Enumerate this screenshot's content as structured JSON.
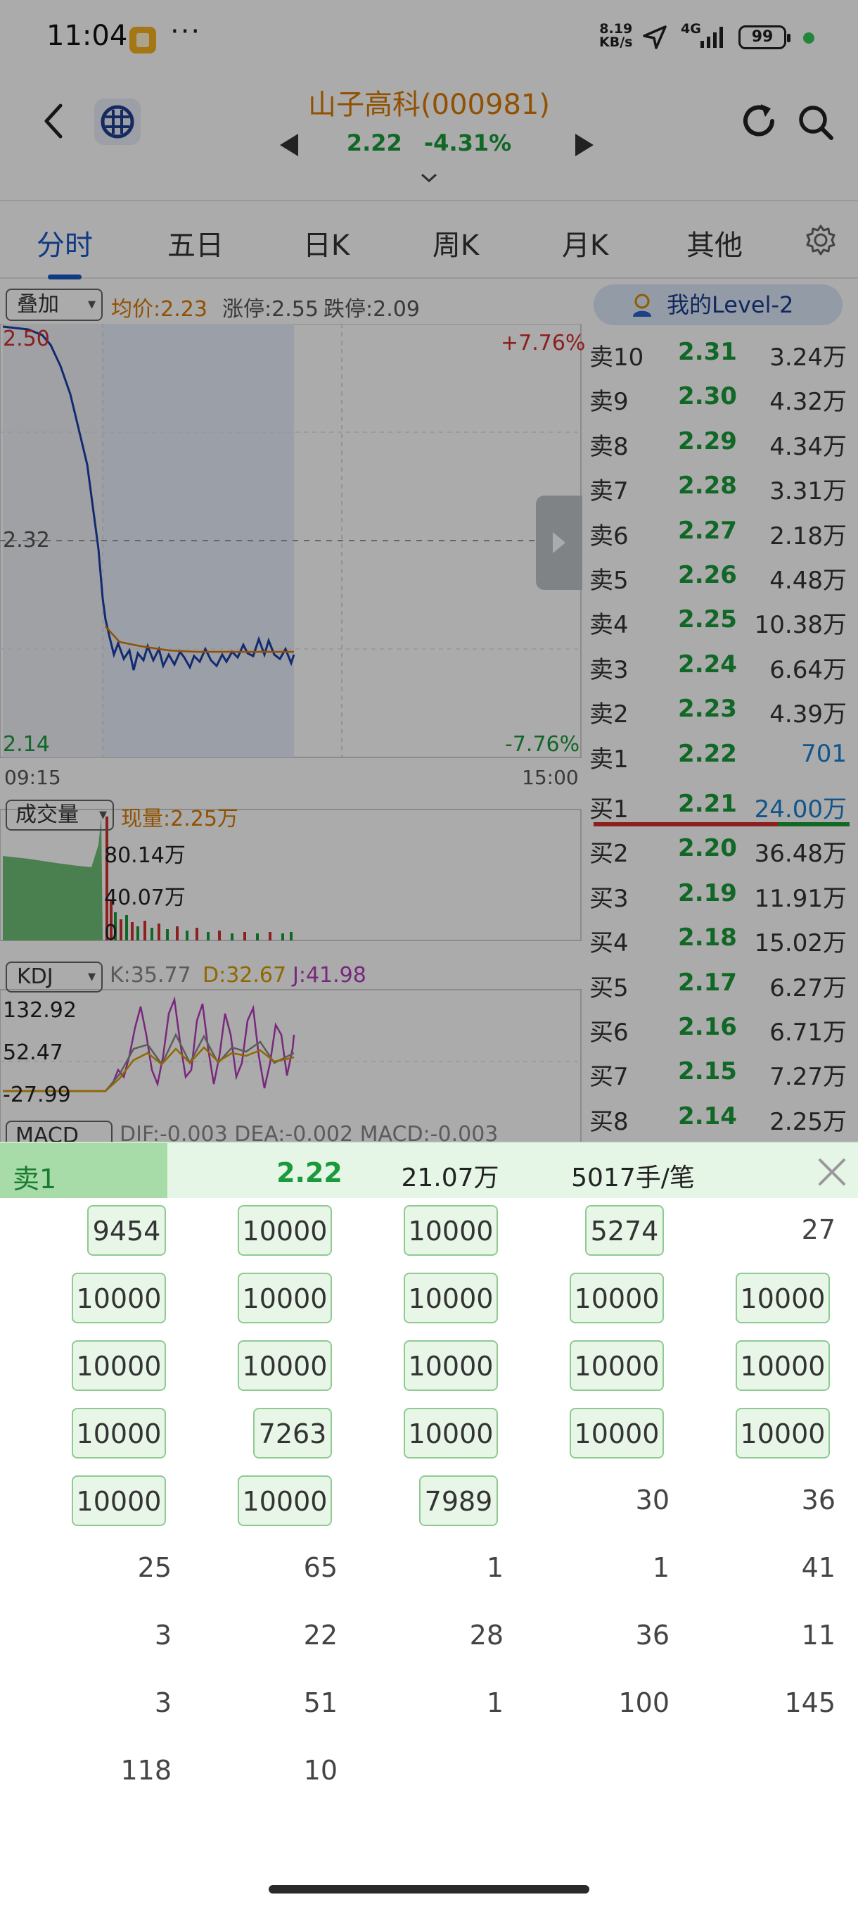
{
  "status_bar": {
    "time": "11:04",
    "more": "···",
    "net_speed_top": "8.19",
    "net_speed_bottom": "KB/s",
    "network": "4G",
    "battery": "99"
  },
  "header": {
    "stock_name": "山子高科(000981)",
    "price": "2.22",
    "change_pct": "-4.31%"
  },
  "tabs": [
    "分时",
    "五日",
    "日K",
    "周K",
    "月K",
    "其他"
  ],
  "chart": {
    "overlay_label": "叠加",
    "avg_price": "均价:2.23",
    "limit_up": "涨停:2.55",
    "limit_down": "跌停:2.09",
    "level2_label": "我的Level-2",
    "y_top": "2.50",
    "y_mid": "2.32",
    "y_bottom": "2.14",
    "pct_top": "+7.76%",
    "pct_bottom": "-7.76%",
    "time_start": "09:15",
    "time_end": "15:00",
    "volume_label": "成交量",
    "volume_now": "现量:2.25万",
    "vol_tick_1": "80.14万",
    "vol_tick_2": "40.07万",
    "vol_tick_3": "0",
    "kdj_label": "KDJ",
    "kdj_k": "K:35.77",
    "kdj_d": "D:32.67",
    "kdj_j": "J:41.98",
    "kdj_tick_1": "132.92",
    "kdj_tick_2": "52.47",
    "kdj_tick_3": "-27.99",
    "macd_label": "MACD",
    "macd_text": "DIF:-0.003   DEA:-0.002   MACD:-0.003"
  },
  "order_book": [
    {
      "label": "卖10",
      "price": "2.31",
      "volume": "3.24万"
    },
    {
      "label": "卖9",
      "price": "2.30",
      "volume": "4.32万"
    },
    {
      "label": "卖8",
      "price": "2.29",
      "volume": "4.34万"
    },
    {
      "label": "卖7",
      "price": "2.28",
      "volume": "3.31万"
    },
    {
      "label": "卖6",
      "price": "2.27",
      "volume": "2.18万"
    },
    {
      "label": "卖5",
      "price": "2.26",
      "volume": "4.48万"
    },
    {
      "label": "卖4",
      "price": "2.25",
      "volume": "10.38万"
    },
    {
      "label": "卖3",
      "price": "2.24",
      "volume": "6.64万"
    },
    {
      "label": "卖2",
      "price": "2.23",
      "volume": "4.39万"
    },
    {
      "label": "卖1",
      "price": "2.22",
      "volume": "701"
    },
    {
      "label": "买1",
      "price": "2.21",
      "volume": "24.00万"
    },
    {
      "label": "买2",
      "price": "2.20",
      "volume": "36.48万"
    },
    {
      "label": "买3",
      "price": "2.19",
      "volume": "11.91万"
    },
    {
      "label": "买4",
      "price": "2.18",
      "volume": "15.02万"
    },
    {
      "label": "买5",
      "price": "2.17",
      "volume": "6.27万"
    },
    {
      "label": "买6",
      "price": "2.16",
      "volume": "6.71万"
    },
    {
      "label": "买7",
      "price": "2.15",
      "volume": "7.27万"
    },
    {
      "label": "买8",
      "price": "2.14",
      "volume": "2.25万"
    }
  ],
  "detail": {
    "side": "卖1",
    "price": "2.22",
    "volume": "21.07万",
    "avg": "5017手/笔",
    "orders": [
      "9454",
      "10000",
      "10000",
      "5274",
      "27",
      "10000",
      "10000",
      "10000",
      "10000",
      "10000",
      "10000",
      "10000",
      "10000",
      "10000",
      "10000",
      "10000",
      "7263",
      "10000",
      "10000",
      "10000",
      "10000",
      "10000",
      "7989",
      "30",
      "36",
      "25",
      "65",
      "1",
      "1",
      "41",
      "3",
      "22",
      "28",
      "36",
      "11",
      "3",
      "51",
      "1",
      "100",
      "145",
      "118",
      "10"
    ]
  },
  "colors": {
    "accent_blue": "#1a57c7",
    "down_green": "#1a9a3a",
    "up_red": "#d0302f",
    "name_orange": "#d97a00"
  }
}
